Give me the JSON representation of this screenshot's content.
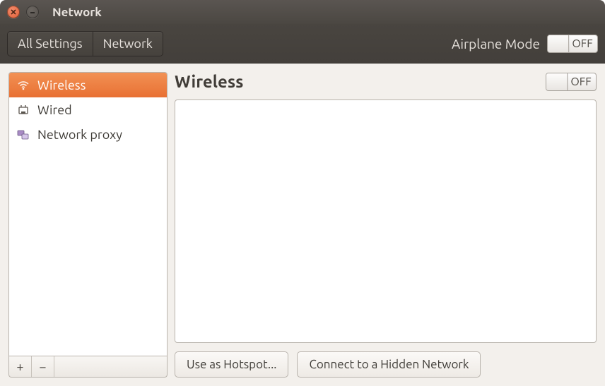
{
  "window": {
    "title": "Network"
  },
  "breadcrumb": {
    "all_settings": "All Settings",
    "current": "Network"
  },
  "airplane": {
    "label": "Airplane Mode",
    "state": "OFF"
  },
  "sidebar": {
    "items": [
      {
        "label": "Wireless",
        "selected": true,
        "icon": "wifi-icon"
      },
      {
        "label": "Wired",
        "selected": false,
        "icon": "ethernet-icon"
      },
      {
        "label": "Network proxy",
        "selected": false,
        "icon": "proxy-icon"
      }
    ],
    "add": "+",
    "remove": "−"
  },
  "content": {
    "title": "Wireless",
    "toggle_state": "OFF",
    "hotspot_btn": "Use as Hotspot...",
    "hidden_btn": "Connect to a Hidden Network"
  }
}
